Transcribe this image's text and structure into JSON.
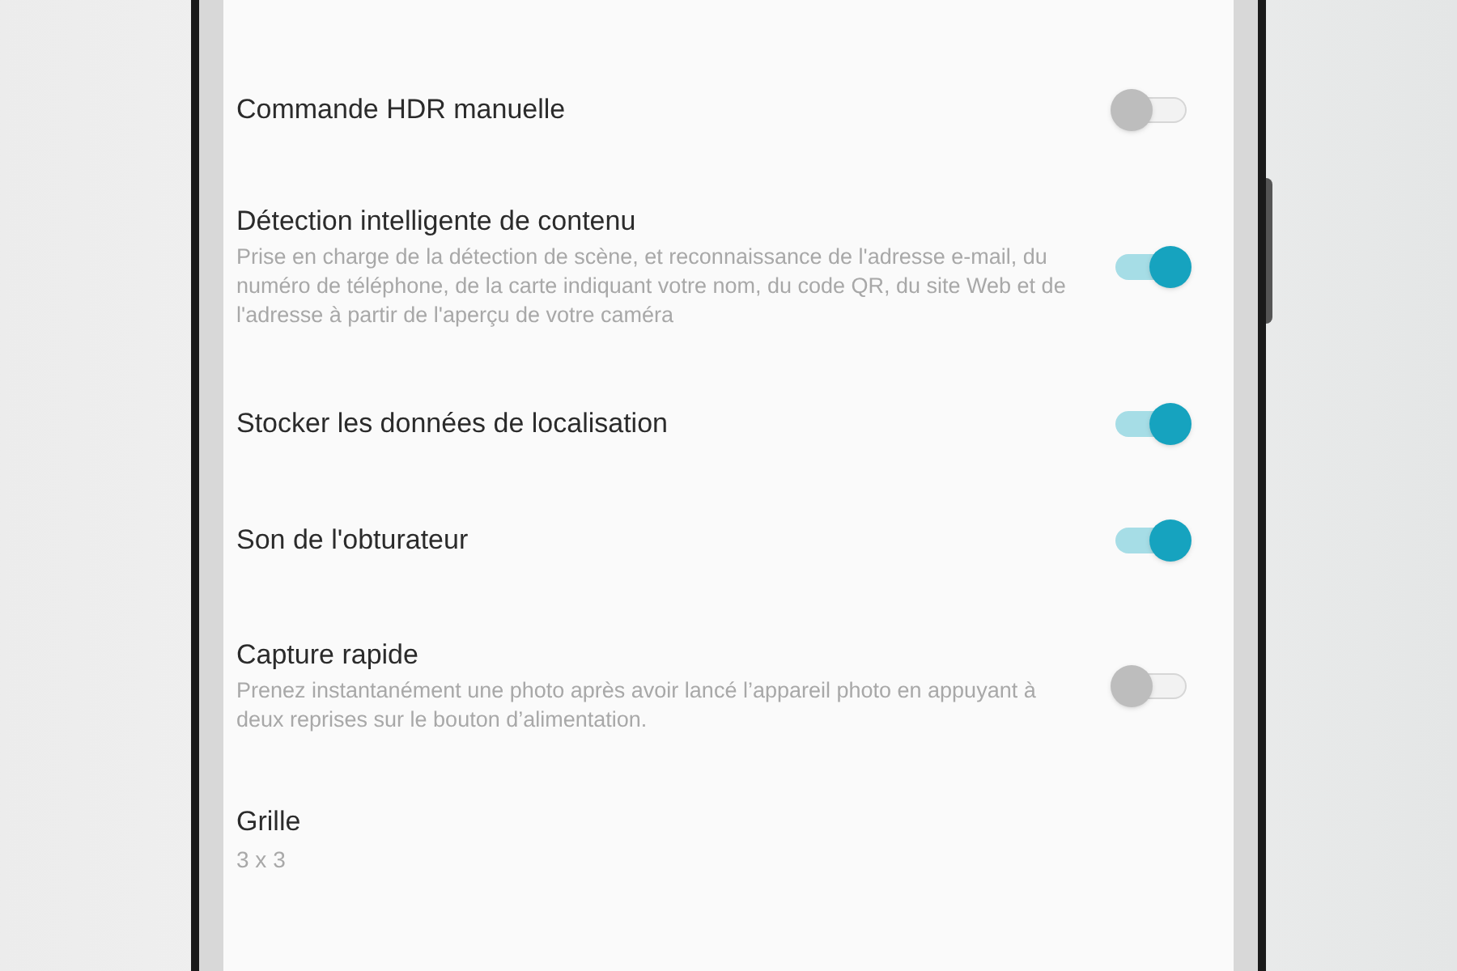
{
  "settings": [
    {
      "kind": "toggle",
      "title": "Commande HDR manuelle",
      "on": false
    },
    {
      "kind": "toggle",
      "title": "Détection intelligente de contenu",
      "description": "Prise en charge de la détection de scène, et reconnaissance de l'adresse e-mail, du numéro de téléphone, de la carte indiquant votre nom, du code QR, du site Web et de l'adresse à partir de l'aperçu de votre caméra",
      "on": true
    },
    {
      "kind": "toggle",
      "title": "Stocker les données de localisation",
      "on": true
    },
    {
      "kind": "toggle",
      "title": "Son de l'obturateur",
      "on": true
    },
    {
      "kind": "toggle",
      "title": "Capture rapide",
      "description": "Prenez instantanément une photo après avoir lancé l’appareil photo en appuyant à deux reprises sur le bouton d’alimentation.",
      "on": false
    },
    {
      "kind": "value",
      "title": "Grille",
      "value": "3 x 3"
    }
  ]
}
